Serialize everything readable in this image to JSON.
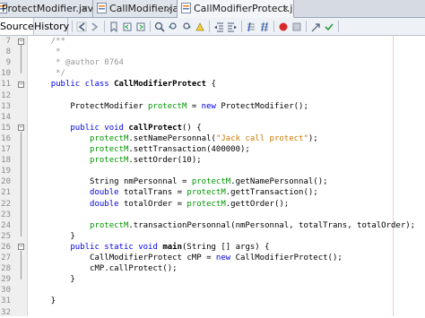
{
  "tabs": [
    {
      "label": "ProtectModifier.java",
      "close": "×"
    },
    {
      "label": "CallModifier.java",
      "close": "×"
    },
    {
      "label": "CallModifierProtect.java",
      "close": "×"
    }
  ],
  "toolbar": {
    "source_label": "Source",
    "history_label": "History",
    "overflow": "▾"
  },
  "lines": [
    {
      "n": "7",
      "tokens": [
        {
          "t": "    /**",
          "c": "cm"
        }
      ]
    },
    {
      "n": "8",
      "tokens": [
        {
          "t": "     *",
          "c": "cm"
        }
      ]
    },
    {
      "n": "9",
      "tokens": [
        {
          "t": "     * @author 0764",
          "c": "cm"
        }
      ]
    },
    {
      "n": "10",
      "tokens": [
        {
          "t": "     */",
          "c": "cm"
        }
      ]
    },
    {
      "n": "11",
      "tokens": [
        {
          "t": "    ",
          "c": ""
        },
        {
          "t": "public class ",
          "c": "kw"
        },
        {
          "t": "CallModifierProtect",
          "c": "b"
        },
        {
          "t": " {",
          "c": ""
        }
      ]
    },
    {
      "n": "12",
      "tokens": []
    },
    {
      "n": "13",
      "tokens": [
        {
          "t": "        ProtectModifier ",
          "c": ""
        },
        {
          "t": "protectM",
          "c": "fld"
        },
        {
          "t": " = ",
          "c": ""
        },
        {
          "t": "new",
          "c": "kw"
        },
        {
          "t": " ProtectModifier();",
          "c": ""
        }
      ]
    },
    {
      "n": "14",
      "tokens": []
    },
    {
      "n": "15",
      "tokens": [
        {
          "t": "        ",
          "c": ""
        },
        {
          "t": "public void ",
          "c": "kw"
        },
        {
          "t": "callProtect",
          "c": "b"
        },
        {
          "t": "() {",
          "c": ""
        }
      ]
    },
    {
      "n": "16",
      "tokens": [
        {
          "t": "            ",
          "c": ""
        },
        {
          "t": "protectM",
          "c": "fld"
        },
        {
          "t": ".setNamePersonnal(",
          "c": ""
        },
        {
          "t": "\"Jack call protect\"",
          "c": "st"
        },
        {
          "t": ");",
          "c": ""
        }
      ]
    },
    {
      "n": "17",
      "tokens": [
        {
          "t": "            ",
          "c": ""
        },
        {
          "t": "protectM",
          "c": "fld"
        },
        {
          "t": ".settTransaction(400000);",
          "c": ""
        }
      ]
    },
    {
      "n": "18",
      "tokens": [
        {
          "t": "            ",
          "c": ""
        },
        {
          "t": "protectM",
          "c": "fld"
        },
        {
          "t": ".settOrder(10);",
          "c": ""
        }
      ]
    },
    {
      "n": "19",
      "tokens": []
    },
    {
      "n": "20",
      "tokens": [
        {
          "t": "            String nmPersonnal = ",
          "c": ""
        },
        {
          "t": "protectM",
          "c": "fld"
        },
        {
          "t": ".getNamePersonnal();",
          "c": ""
        }
      ]
    },
    {
      "n": "21",
      "tokens": [
        {
          "t": "            ",
          "c": ""
        },
        {
          "t": "double",
          "c": "kw"
        },
        {
          "t": " totalTrans = ",
          "c": ""
        },
        {
          "t": "protectM",
          "c": "fld"
        },
        {
          "t": ".gettTransaction();",
          "c": ""
        }
      ]
    },
    {
      "n": "22",
      "tokens": [
        {
          "t": "            ",
          "c": ""
        },
        {
          "t": "double",
          "c": "kw"
        },
        {
          "t": " totalOrder = ",
          "c": ""
        },
        {
          "t": "protectM",
          "c": "fld"
        },
        {
          "t": ".gettOrder();",
          "c": ""
        }
      ]
    },
    {
      "n": "23",
      "tokens": []
    },
    {
      "n": "24",
      "tokens": [
        {
          "t": "            ",
          "c": ""
        },
        {
          "t": "protectM",
          "c": "fld"
        },
        {
          "t": ".transactionPersonnal(nmPersonnal, totalTrans, totalOrder);",
          "c": ""
        }
      ]
    },
    {
      "n": "25",
      "tokens": [
        {
          "t": "        }",
          "c": ""
        }
      ]
    },
    {
      "n": "26",
      "tokens": [
        {
          "t": "        ",
          "c": ""
        },
        {
          "t": "public static void ",
          "c": "kw"
        },
        {
          "t": "main",
          "c": "b"
        },
        {
          "t": "(String [] args) {",
          "c": ""
        }
      ]
    },
    {
      "n": "27",
      "tokens": [
        {
          "t": "            CallModifierProtect cMP = ",
          "c": ""
        },
        {
          "t": "new",
          "c": "kw"
        },
        {
          "t": " CallModifierProtect();",
          "c": ""
        }
      ]
    },
    {
      "n": "28",
      "tokens": [
        {
          "t": "            cMP.callProtect();",
          "c": ""
        }
      ]
    },
    {
      "n": "29",
      "tokens": [
        {
          "t": "        }",
          "c": ""
        }
      ]
    },
    {
      "n": "30",
      "tokens": []
    },
    {
      "n": "31",
      "tokens": [
        {
          "t": "    }",
          "c": ""
        }
      ]
    },
    {
      "n": "32",
      "tokens": []
    }
  ],
  "toolbar_icons": [
    "back-icon",
    "forward-icon",
    "toggle-bookmark-icon",
    "prev-bookmark-icon",
    "next-bookmark-icon",
    "find-selection-icon",
    "find-prev-icon",
    "find-next-icon",
    "toggle-highlight-icon",
    "shift-left-icon",
    "shift-right-icon",
    "comment-icon",
    "uncomment-icon",
    "start-macro-icon",
    "stop-macro-icon",
    "diff-icon",
    "check-icon"
  ]
}
